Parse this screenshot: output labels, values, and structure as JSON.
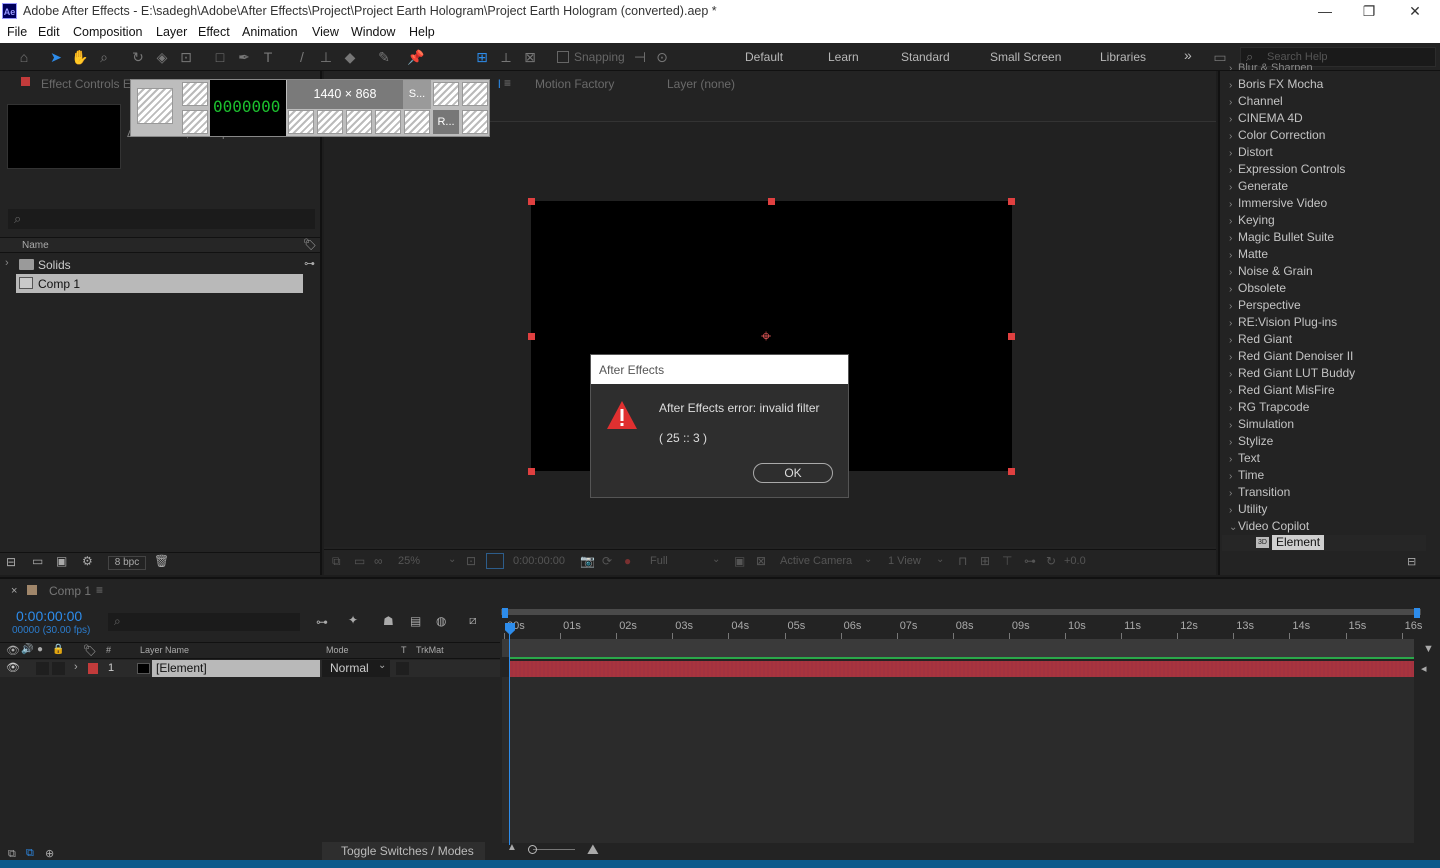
{
  "window": {
    "app_logo": "Ae",
    "title": "Adobe After Effects - E:\\sadegh\\Adobe\\After Effects\\Project\\Project Earth Hologram\\Project Earth Hologram (converted).aep *",
    "minimize": "—",
    "restore": "❐",
    "close": "✕"
  },
  "menu": [
    "File",
    "Edit",
    "Composition",
    "Layer",
    "Effect",
    "Animation",
    "View",
    "Window",
    "Help"
  ],
  "toolbar": {
    "snapping": "Snapping",
    "workspaces": [
      "Default",
      "Learn",
      "Standard",
      "Small Screen",
      "Libraries"
    ],
    "more": "»",
    "search_placeholder": "Search Help"
  },
  "project_panel": {
    "tab": "Effect Controls Ele",
    "search_placeholder": "",
    "col_name": "Name",
    "items": [
      {
        "name": "Solids",
        "type": "folder"
      },
      {
        "name": "Comp 1",
        "type": "comp"
      }
    ],
    "bpc": "8 bpc",
    "comp_info": "Δ 0:00:00:00 , 30.00 fps"
  },
  "overlay": {
    "size_label": "1440 × 868",
    "counter": "0000000",
    "btn_s": "S...",
    "btn_r": "R..."
  },
  "viewer": {
    "tabs": [
      "Motion Factory",
      "Layer  (none)"
    ],
    "zoom": "25%",
    "timecode": "0:00:00:00",
    "resolution": "Full",
    "camera": "Active Camera",
    "views": "1 View",
    "offset": "+0.0"
  },
  "dialog": {
    "title": "After Effects",
    "message": "After Effects error: invalid filter",
    "code": "( 25 :: 3 )",
    "ok": "OK"
  },
  "effects": {
    "top_cut": "Blur & Sharpen",
    "categories": [
      "Boris FX Mocha",
      "Channel",
      "CINEMA 4D",
      "Color Correction",
      "Distort",
      "Expression Controls",
      "Generate",
      "Immersive Video",
      "Keying",
      "Magic Bullet Suite",
      "Matte",
      "Noise & Grain",
      "Obsolete",
      "Perspective",
      "RE:Vision Plug-ins",
      "Red Giant",
      "Red Giant Denoiser II",
      "Red Giant LUT Buddy",
      "Red Giant MisFire",
      "RG Trapcode",
      "Simulation",
      "Stylize",
      "Text",
      "Time",
      "Transition",
      "Utility"
    ],
    "expanded": "Video Copilot",
    "selected_effect": "Element"
  },
  "timeline": {
    "tab": "Comp 1",
    "timecode": "0:00:00:00",
    "frames": "00000 (30.00 fps)",
    "col_layer_name": "Layer Name",
    "col_mode": "Mode",
    "col_t": "T",
    "col_trkmat": "TrkMat",
    "col_hash": "#",
    "ruler": [
      "00s",
      "01s",
      "02s",
      "03s",
      "04s",
      "05s",
      "06s",
      "07s",
      "08s",
      "09s",
      "10s",
      "11s",
      "12s",
      "13s",
      "14s",
      "15s",
      "16s"
    ],
    "layers": [
      {
        "num": "1",
        "name": "[Element]",
        "mode": "Normal",
        "color": "#c23b3b"
      }
    ],
    "toggle": "Toggle Switches / Modes"
  },
  "colors": {
    "accent_blue": "#2d8ceb",
    "layer_bar": "#a8343e",
    "handle_red": "#e04040",
    "error_red": "#e03030"
  }
}
